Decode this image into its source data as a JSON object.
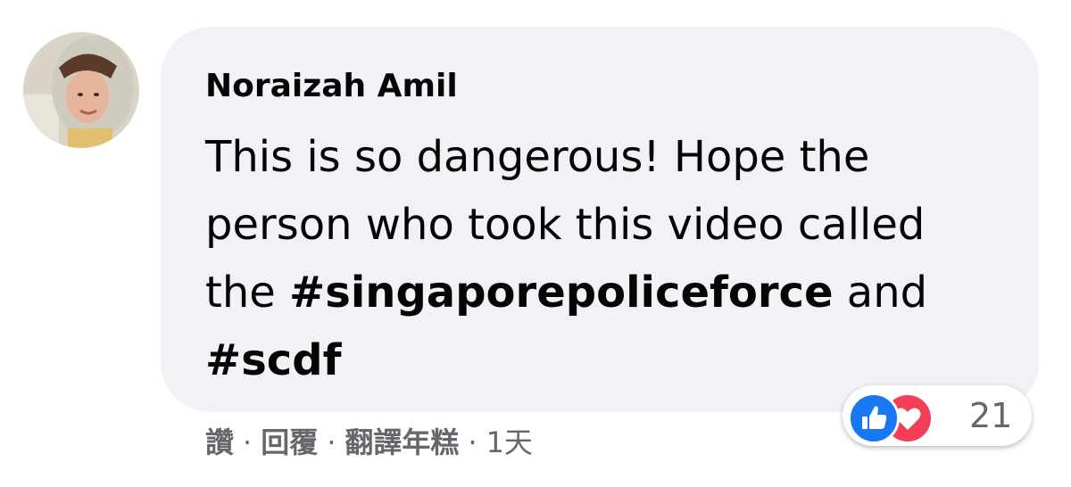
{
  "comment": {
    "author": "Noraizah Amil",
    "text_before": "This is so dangerous! Hope the person who took this video called the ",
    "hashtag_1": "#singaporepoliceforce",
    "text_middle": " and ",
    "hashtag_2": "#scdf"
  },
  "actions": {
    "like": "讚",
    "reply": "回覆",
    "translate": "翻譯年糕",
    "separator": "·",
    "time": "1天"
  },
  "reactions": {
    "icons": [
      "like-icon",
      "love-icon"
    ],
    "count": "21",
    "colors": {
      "like": "#1877f2",
      "love": "#f33e58"
    }
  }
}
